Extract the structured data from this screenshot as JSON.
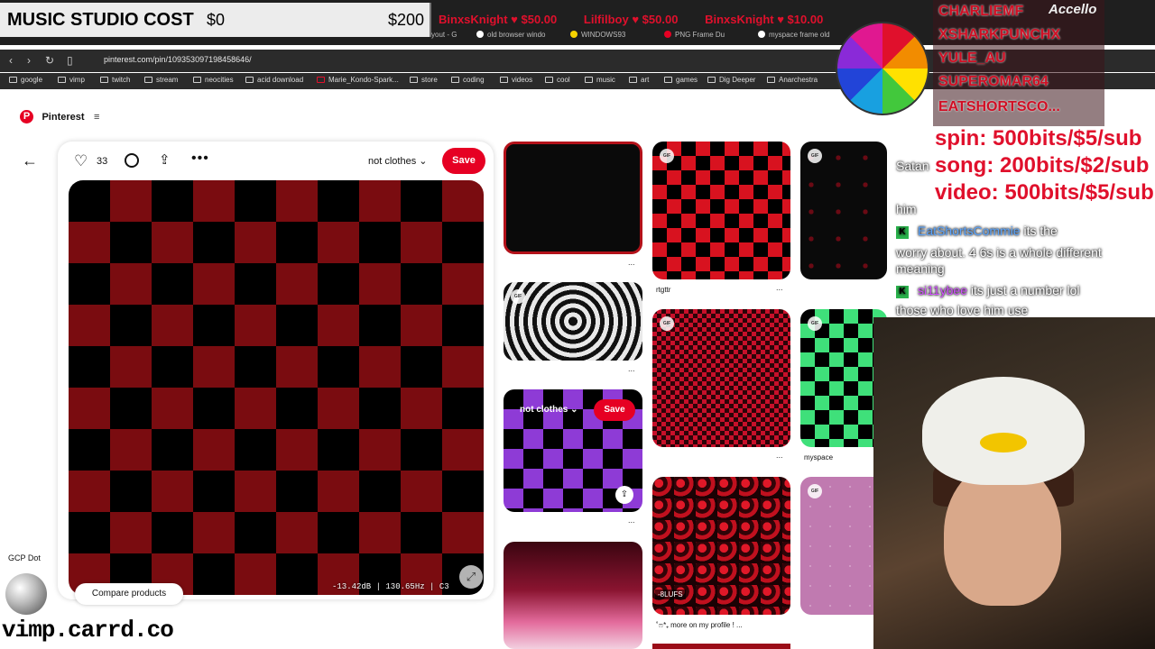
{
  "browser": {
    "tabs": [
      {
        "label": "yout - G"
      },
      {
        "label": "old browser windo"
      },
      {
        "label": "WINDOWS93"
      },
      {
        "label": "PNG Frame Du"
      },
      {
        "label": "myspace frame old"
      }
    ],
    "url": "pinterest.com/pin/109353097198458646/",
    "bookmarks": [
      "google",
      "vimp",
      "twitch",
      "stream",
      "neocities",
      "acid download",
      "Marie_Kondo-Spark...",
      "store",
      "coding",
      "videos",
      "cool",
      "music",
      "art",
      "games",
      "Dig Deeper",
      "Anarchestra"
    ]
  },
  "overlay": {
    "cost_title": "MUSIC STUDIO COST",
    "cost_min": "$0",
    "cost_max": "$200",
    "donors": [
      "BinxsKnight ♥ $50.00",
      "Lilfilboy ♥ $50.00",
      "BinxsKnight ♥ $10.00"
    ],
    "leaderboard": [
      "CHARLIEMF",
      "XSHARKPUNCHX",
      "YULE_AU",
      "SUPEROMAR64",
      "EATSHORTSCO..."
    ],
    "brand": "Accello",
    "prices": [
      "spin: 500bits/$5/sub",
      "song: 200bits/$2/sub",
      "video: 500bits/$5/sub"
    ],
    "chat": [
      {
        "user": "",
        "text": "Satan"
      },
      {
        "user": "",
        "text": "him"
      },
      {
        "user": "EatShortsCommie",
        "text": " its the"
      },
      {
        "user": "",
        "text": "worry about. 4 6s is a whole different"
      },
      {
        "user": "",
        "text": "meaning"
      },
      {
        "user": "si11ybee",
        "text": " its just a number lol"
      },
      {
        "user": "",
        "text": "those who love him use"
      }
    ],
    "gcp_label": "GCP Dot",
    "carrd": "vimp.carrd.co",
    "audio_meter": "-13.42dB | 130.65Hz | C3",
    "lufs": "-8LUFS"
  },
  "pinterest": {
    "logo_letter": "P",
    "wordmark": "Pinterest",
    "menu_icon": "≡",
    "like_count": "33",
    "board": "not clothes",
    "save_label": "Save",
    "grid": {
      "pin2_caption": "rtgttr",
      "pin_green_caption": "myspace",
      "pin_leopard_caption": "˚ෆ*₊ more on my profile ! ...",
      "hover_board": "not clothes",
      "hover_save": "Save",
      "gif_badge": "GIF",
      "dots": "..."
    },
    "compare_label": "Compare products"
  },
  "colors": {
    "brand_red": "#e60023",
    "donor_red": "#e0102c"
  }
}
